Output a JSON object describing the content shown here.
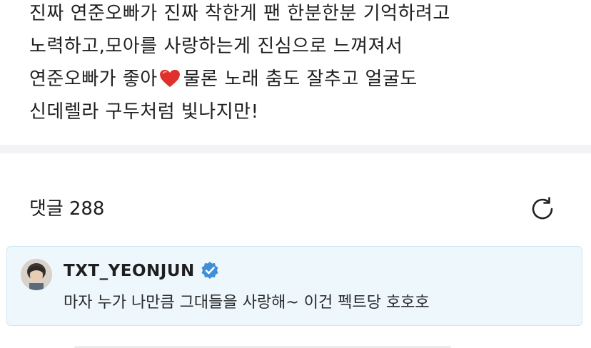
{
  "post": {
    "lines": [
      "진짜 연준오빠가 진짜 착한게 팬 한분한분 기억하려고",
      "노력하고,모아를 사랑하는게 진심으로 느껴져서",
      "연준오빠가 좋아",
      "물론 노래 춤도 잘추고 얼굴도",
      "신데렐라 구두처럼 빛나지만!"
    ],
    "heart_icon": "red-heart-emoji"
  },
  "comments": {
    "label": "댓글",
    "count": "288",
    "refresh_icon": "refresh-icon"
  },
  "pinned_comment": {
    "author": "TXT_YEONJUN",
    "verified_icon": "verified-badge-icon",
    "text": "마자 누가 나만큼 그대들을 사랑해~ 이건 펙트당 호호호",
    "background_color": "#eef7fc",
    "verified_color": "#3f8fd8"
  }
}
